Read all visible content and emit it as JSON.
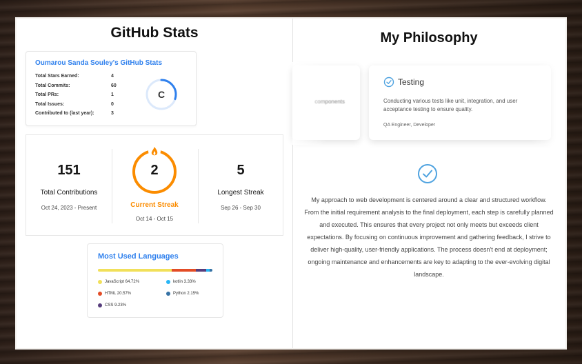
{
  "github": {
    "title": "GitHub Stats",
    "stats_card": {
      "title": "Oumarou Sanda Souley's GitHub Stats",
      "rows": [
        {
          "label": "Total Stars Earned:",
          "value": "4"
        },
        {
          "label": "Total Commits:",
          "value": "60"
        },
        {
          "label": "Total PRs:",
          "value": "1"
        },
        {
          "label": "Total Issues:",
          "value": "0"
        },
        {
          "label": "Contributed to (last year):",
          "value": "3"
        }
      ],
      "rank": "C",
      "rank_fraction": 0.3,
      "rank_color": "#2f80ed"
    },
    "streak": {
      "total": {
        "value": "151",
        "label": "Total Contributions",
        "range": "Oct 24, 2023 - Present"
      },
      "current": {
        "value": "2",
        "label": "Current Streak",
        "range": "Oct 14 - Oct 15"
      },
      "longest": {
        "value": "5",
        "label": "Longest Streak",
        "range": "Sep 26 - Sep 30"
      },
      "accent": "#fb8c00"
    },
    "languages": {
      "title": "Most Used Languages",
      "items": [
        {
          "name": "JavaScript 64.72%",
          "percent": 64.72,
          "color": "#f1e05a"
        },
        {
          "name": "HTML 20.57%",
          "percent": 20.57,
          "color": "#e34c26"
        },
        {
          "name": "CSS 9.23%",
          "percent": 9.23,
          "color": "#563d7c"
        },
        {
          "name": "kotlin 3.33%",
          "percent": 3.33,
          "color": "#29b6f6"
        },
        {
          "name": "Python 2.15%",
          "percent": 2.15,
          "color": "#3572a5"
        }
      ]
    }
  },
  "philosophy": {
    "title": "My Philosophy",
    "card_left_text": "components",
    "testing_card": {
      "icon": "check-circle-icon",
      "title": "Testing",
      "description": "Conducting various tests like unit, integration, and user acceptance testing to ensure quality.",
      "roles": "QA Engineer, Developer"
    },
    "icon": "check-circle-icon",
    "text": "My approach to web development is centered around a clear and structured workflow. From the initial requirement analysis to the final deployment, each step is carefully planned and executed. This ensures that every project not only meets but exceeds client expectations. By focusing on continuous improvement and gathering feedback, I strive to deliver high-quality, user-friendly applications. The process doesn't end at deployment; ongoing maintenance and enhancements are key to adapting to the ever-evolving digital landscape.",
    "accent": "#4fa3e0"
  }
}
